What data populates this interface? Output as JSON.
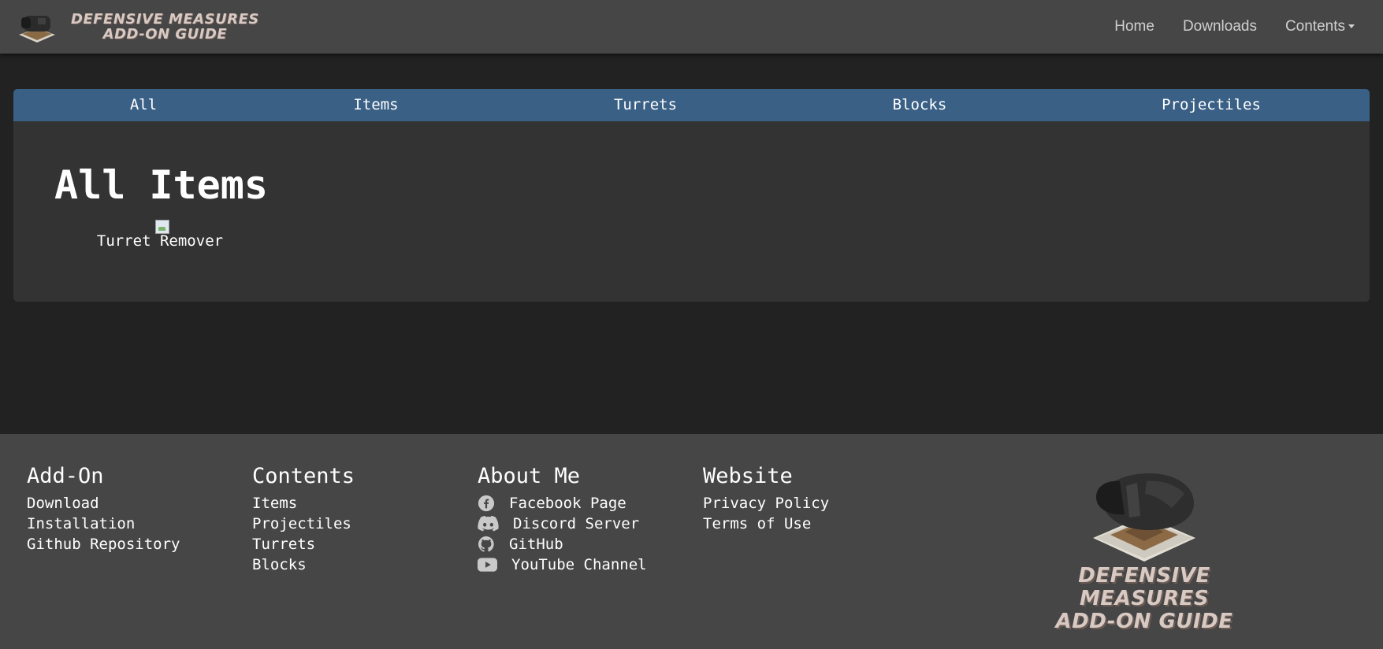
{
  "brand": {
    "line1": "DEFENSIVE MEASURES",
    "line2": "ADD-ON GUIDE"
  },
  "nav": {
    "home": "Home",
    "downloads": "Downloads",
    "contents": "Contents"
  },
  "tabs": [
    "All",
    "Items",
    "Turrets",
    "Blocks",
    "Projectiles"
  ],
  "main": {
    "title": "All Items",
    "items": [
      {
        "label": "Turret Remover"
      }
    ]
  },
  "footer": {
    "addon": {
      "heading": "Add-On",
      "links": [
        "Download",
        "Installation",
        "Github Repository"
      ]
    },
    "contents": {
      "heading": "Contents",
      "links": [
        "Items",
        "Projectiles",
        "Turrets",
        "Blocks"
      ]
    },
    "about": {
      "heading": "About Me",
      "links": [
        {
          "label": "Facebook Page",
          "icon": "facebook-icon"
        },
        {
          "label": "Discord Server",
          "icon": "discord-icon"
        },
        {
          "label": "GitHub",
          "icon": "github-icon"
        },
        {
          "label": "YouTube Channel",
          "icon": "youtube-icon"
        }
      ]
    },
    "website": {
      "heading": "Website",
      "links": [
        "Privacy Policy",
        "Terms of Use"
      ]
    },
    "logo": {
      "line1": "DEFENSIVE MEASURES",
      "line2": "ADD-ON GUIDE"
    }
  },
  "colors": {
    "page_bg": "#222222",
    "navbar_bg": "#464646",
    "card_bg": "#333333",
    "tab_bar_bg": "#3a6086",
    "footer_bg": "#464646",
    "brand_text": "#d8c9c3"
  }
}
